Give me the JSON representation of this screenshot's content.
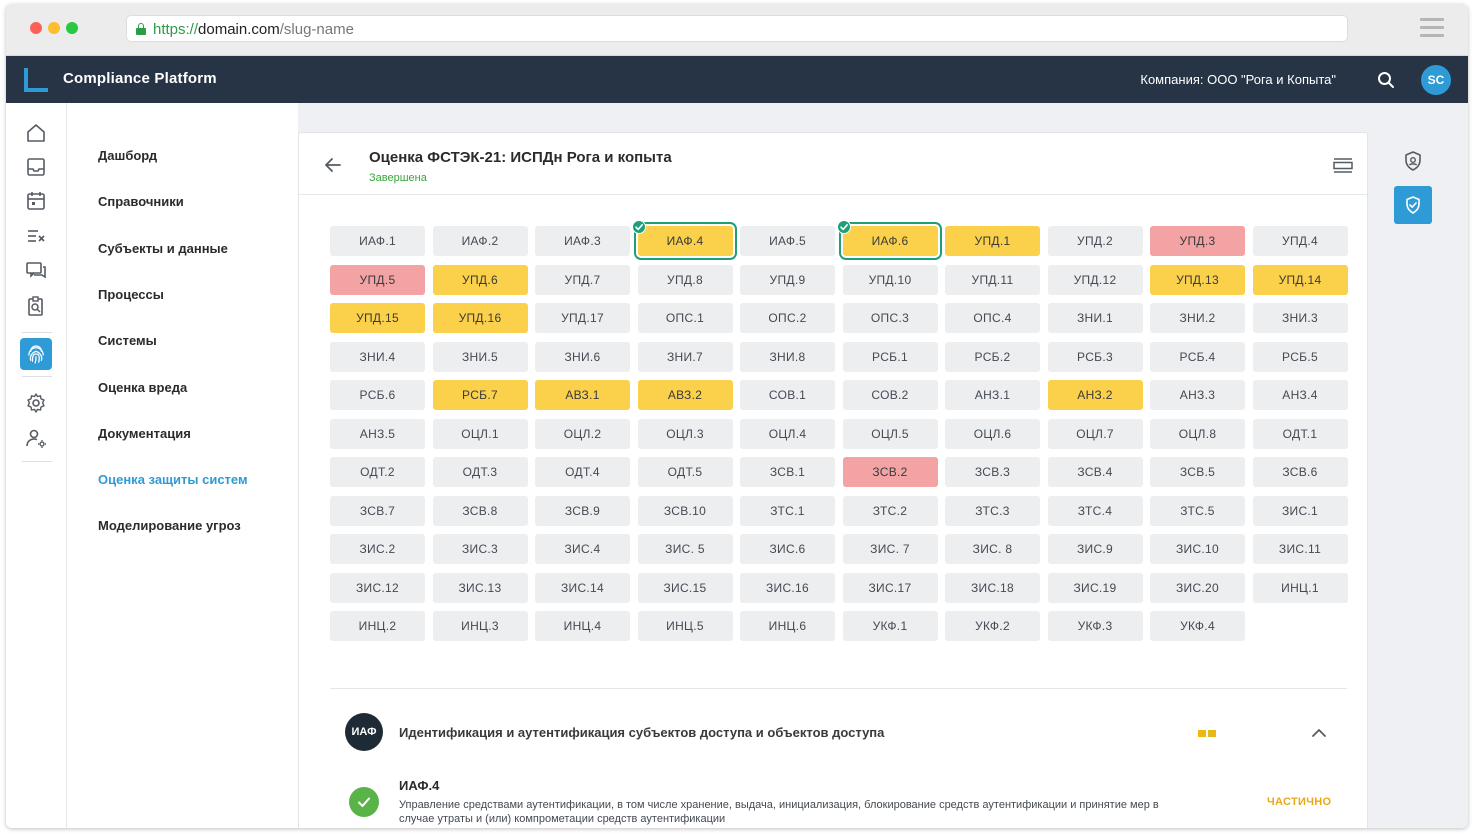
{
  "browser": {
    "url_scheme": "https://",
    "url_host": "domain.com",
    "url_path": "/slug-name"
  },
  "header": {
    "app_title": "Compliance Platform",
    "company": "Компания: ООО \"Рога и Копыта\"",
    "avatar_initials": "SC",
    "icons": [
      "search-icon"
    ]
  },
  "rail": {
    "icons": [
      "home-icon",
      "inbox-icon",
      "calendar-icon",
      "checklist-icon",
      "chat-icon",
      "clipboard-search-icon",
      "fingerprint-icon",
      "gear-icon",
      "user-settings-icon"
    ],
    "active": "fingerprint-icon"
  },
  "nav": {
    "items": [
      {
        "label": "Дашборд"
      },
      {
        "label": "Справочники"
      },
      {
        "label": "Субъекты и данные"
      },
      {
        "label": "Процессы"
      },
      {
        "label": "Системы"
      },
      {
        "label": "Оценка вреда"
      },
      {
        "label": "Документация"
      },
      {
        "label": "Оценка защиты систем"
      },
      {
        "label": "Моделирование угроз"
      }
    ],
    "active_index": 7
  },
  "card": {
    "title": "Оценка ФСТЭК-21: ИСПДн Рога и копыта",
    "status": "Завершена"
  },
  "controls": [
    {
      "code": "ИАФ.1",
      "state": "none"
    },
    {
      "code": "ИАФ.2",
      "state": "none"
    },
    {
      "code": "ИАФ.3",
      "state": "none"
    },
    {
      "code": "ИАФ.4",
      "state": "partial",
      "selected": true
    },
    {
      "code": "ИАФ.5",
      "state": "none"
    },
    {
      "code": "ИАФ.6",
      "state": "partial",
      "selected": true
    },
    {
      "code": "УПД.1",
      "state": "partial"
    },
    {
      "code": "УПД.2",
      "state": "none"
    },
    {
      "code": "УПД.3",
      "state": "fail"
    },
    {
      "code": "УПД.4",
      "state": "none"
    },
    {
      "code": "УПД.5",
      "state": "fail"
    },
    {
      "code": "УПД.6",
      "state": "partial"
    },
    {
      "code": "УПД.7",
      "state": "none"
    },
    {
      "code": "УПД.8",
      "state": "none"
    },
    {
      "code": "УПД.9",
      "state": "none"
    },
    {
      "code": "УПД.10",
      "state": "none"
    },
    {
      "code": "УПД.11",
      "state": "none"
    },
    {
      "code": "УПД.12",
      "state": "none"
    },
    {
      "code": "УПД.13",
      "state": "partial"
    },
    {
      "code": "УПД.14",
      "state": "partial"
    },
    {
      "code": "УПД.15",
      "state": "partial"
    },
    {
      "code": "УПД.16",
      "state": "partial"
    },
    {
      "code": "УПД.17",
      "state": "none"
    },
    {
      "code": "ОПС.1",
      "state": "none"
    },
    {
      "code": "ОПС.2",
      "state": "none"
    },
    {
      "code": "ОПС.3",
      "state": "none"
    },
    {
      "code": "ОПС.4",
      "state": "none"
    },
    {
      "code": "ЗНИ.1",
      "state": "none"
    },
    {
      "code": "ЗНИ.2",
      "state": "none"
    },
    {
      "code": "ЗНИ.3",
      "state": "none"
    },
    {
      "code": "ЗНИ.4",
      "state": "none"
    },
    {
      "code": "ЗНИ.5",
      "state": "none"
    },
    {
      "code": "ЗНИ.6",
      "state": "none"
    },
    {
      "code": "ЗНИ.7",
      "state": "none"
    },
    {
      "code": "ЗНИ.8",
      "state": "none"
    },
    {
      "code": "РСБ.1",
      "state": "none"
    },
    {
      "code": "РСБ.2",
      "state": "none"
    },
    {
      "code": "РСБ.3",
      "state": "none"
    },
    {
      "code": "РСБ.4",
      "state": "none"
    },
    {
      "code": "РСБ.5",
      "state": "none"
    },
    {
      "code": "РСБ.6",
      "state": "none"
    },
    {
      "code": "РСБ.7",
      "state": "partial"
    },
    {
      "code": "АВЗ.1",
      "state": "partial"
    },
    {
      "code": "АВЗ.2",
      "state": "partial"
    },
    {
      "code": "СОВ.1",
      "state": "none"
    },
    {
      "code": "СОВ.2",
      "state": "none"
    },
    {
      "code": "АНЗ.1",
      "state": "none"
    },
    {
      "code": "АНЗ.2",
      "state": "partial"
    },
    {
      "code": "АНЗ.3",
      "state": "none"
    },
    {
      "code": "АНЗ.4",
      "state": "none"
    },
    {
      "code": "АНЗ.5",
      "state": "none"
    },
    {
      "code": "ОЦЛ.1",
      "state": "none"
    },
    {
      "code": "ОЦЛ.2",
      "state": "none"
    },
    {
      "code": "ОЦЛ.3",
      "state": "none"
    },
    {
      "code": "ОЦЛ.4",
      "state": "none"
    },
    {
      "code": "ОЦЛ.5",
      "state": "none"
    },
    {
      "code": "ОЦЛ.6",
      "state": "none"
    },
    {
      "code": "ОЦЛ.7",
      "state": "none"
    },
    {
      "code": "ОЦЛ.8",
      "state": "none"
    },
    {
      "code": "ОДТ.1",
      "state": "none"
    },
    {
      "code": "ОДТ.2",
      "state": "none"
    },
    {
      "code": "ОДТ.3",
      "state": "none"
    },
    {
      "code": "ОДТ.4",
      "state": "none"
    },
    {
      "code": "ОДТ.5",
      "state": "none"
    },
    {
      "code": "ЗСВ.1",
      "state": "none"
    },
    {
      "code": "ЗСВ.2",
      "state": "fail"
    },
    {
      "code": "ЗСВ.3",
      "state": "none"
    },
    {
      "code": "ЗСВ.4",
      "state": "none"
    },
    {
      "code": "ЗСВ.5",
      "state": "none"
    },
    {
      "code": "ЗСВ.6",
      "state": "none"
    },
    {
      "code": "ЗСВ.7",
      "state": "none"
    },
    {
      "code": "ЗСВ.8",
      "state": "none"
    },
    {
      "code": "ЗСВ.9",
      "state": "none"
    },
    {
      "code": "ЗСВ.10",
      "state": "none"
    },
    {
      "code": "ЗТС.1",
      "state": "none"
    },
    {
      "code": "ЗТС.2",
      "state": "none"
    },
    {
      "code": "ЗТС.3",
      "state": "none"
    },
    {
      "code": "ЗТС.4",
      "state": "none"
    },
    {
      "code": "ЗТС.5",
      "state": "none"
    },
    {
      "code": "ЗИС.1",
      "state": "none"
    },
    {
      "code": "ЗИС.2",
      "state": "none"
    },
    {
      "code": "ЗИС.3",
      "state": "none"
    },
    {
      "code": "ЗИС.4",
      "state": "none"
    },
    {
      "code": "ЗИС. 5",
      "state": "none"
    },
    {
      "code": "ЗИС.6",
      "state": "none"
    },
    {
      "code": "ЗИС. 7",
      "state": "none"
    },
    {
      "code": "ЗИС. 8",
      "state": "none"
    },
    {
      "code": "ЗИС.9",
      "state": "none"
    },
    {
      "code": "ЗИС.10",
      "state": "none"
    },
    {
      "code": "ЗИС.11",
      "state": "none"
    },
    {
      "code": "ЗИС.12",
      "state": "none"
    },
    {
      "code": "ЗИС.13",
      "state": "none"
    },
    {
      "code": "ЗИС.14",
      "state": "none"
    },
    {
      "code": "ЗИС.15",
      "state": "none"
    },
    {
      "code": "ЗИС.16",
      "state": "none"
    },
    {
      "code": "ЗИС.17",
      "state": "none"
    },
    {
      "code": "ЗИС.18",
      "state": "none"
    },
    {
      "code": "ЗИС.19",
      "state": "none"
    },
    {
      "code": "ЗИС.20",
      "state": "none"
    },
    {
      "code": "ИНЦ.1",
      "state": "none"
    },
    {
      "code": "ИНЦ.2",
      "state": "none"
    },
    {
      "code": "ИНЦ.3",
      "state": "none"
    },
    {
      "code": "ИНЦ.4",
      "state": "none"
    },
    {
      "code": "ИНЦ.5",
      "state": "none"
    },
    {
      "code": "ИНЦ.6",
      "state": "none"
    },
    {
      "code": "УКФ.1",
      "state": "none"
    },
    {
      "code": "УКФ.2",
      "state": "none"
    },
    {
      "code": "УКФ.3",
      "state": "none"
    },
    {
      "code": "УКФ.4",
      "state": "none"
    }
  ],
  "section": {
    "badge": "ИАФ",
    "title": "Идентификация и аутентификация субъектов доступа и объектов доступа"
  },
  "requirement": {
    "code": "ИАФ.4",
    "description": "Управление средствами аутентификации, в том числе хранение, выдача, инициализация, блокирование средств аутентификации и принятие мер в случае утраты и (или) компрометации средств аутентификации",
    "status": "ЧАСТИЧНО"
  },
  "colors": {
    "header_bg": "#263445",
    "accent": "#2e9bd6",
    "partial": "#fbd04a",
    "fail": "#f4a3a5",
    "neutral": "#eceef0",
    "selected_outline": "#1e9f78",
    "status_done": "#3aa63a",
    "status_partial": "#e8a817"
  }
}
